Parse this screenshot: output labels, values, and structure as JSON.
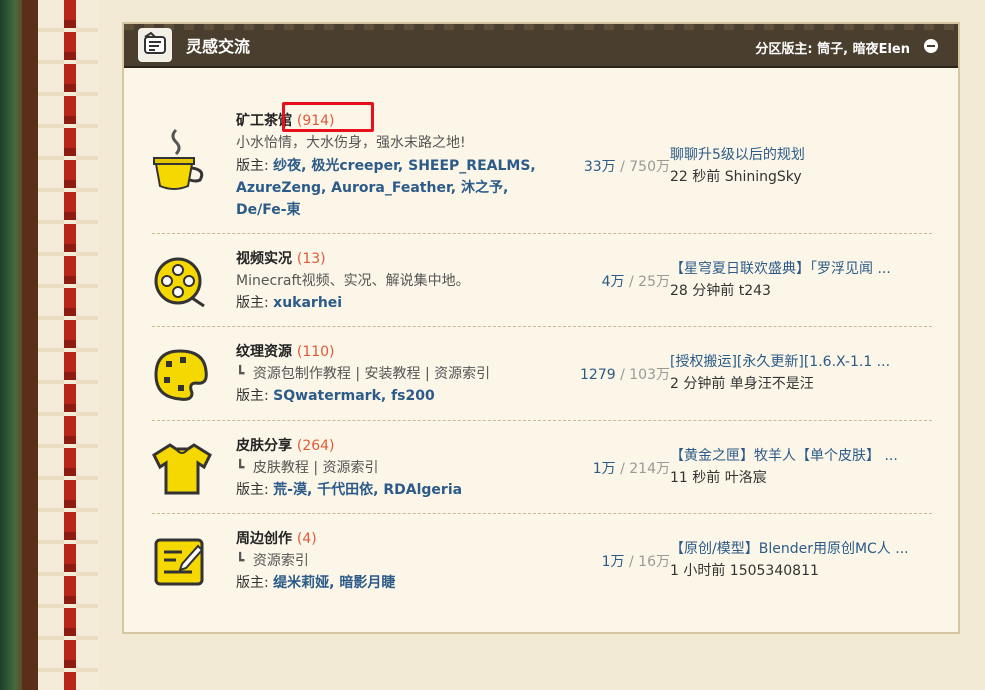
{
  "section": {
    "title": "灵感交流",
    "moderators_label": "分区版主: 筒子, 暗夜Elen"
  },
  "forums": [
    {
      "icon": "teacup-icon",
      "name": "矿工茶馆",
      "count": "(914)",
      "description": "小水怡情，大水伤身，强水末路之地!",
      "mod_label": "版主:",
      "mods_line1": "纱夜, 极光creeper, SHEEP_REALMS,",
      "mods_line2": "AzureZeng, Aurora_Feather, 沐之予,",
      "mods_line3": "De/Fe-東",
      "threads": "33万",
      "posts": "750万",
      "last_title": "聊聊升5级以后的规划",
      "last_meta": "22 秒前 ShiningSky"
    },
    {
      "icon": "film-reel-icon",
      "name": "视频实况",
      "count": "(13)",
      "description": "Minecraft视频、实况、解说集中地。",
      "mod_label": "版主:",
      "mods_line1": "xukarhei",
      "threads": "4万",
      "posts": "25万",
      "last_title": "【星穹夏日联欢盛典】「罗浮见闻 ...",
      "last_meta": "28 分钟前 t243"
    },
    {
      "icon": "palette-icon",
      "name": "纹理资源",
      "count": "(110)",
      "sublinks": "资源包制作教程 | 安装教程 | 资源索引",
      "mod_label": "版主:",
      "mods_line1": "SQwatermark, fs200",
      "threads": "1279",
      "posts": "103万",
      "last_title": "[授权搬运][永久更新][1.6.X-1.1 ...",
      "last_meta": "2 分钟前 单身汪不是汪"
    },
    {
      "icon": "shirt-icon",
      "name": "皮肤分享",
      "count": "(264)",
      "sublinks": "皮肤教程 | 资源索引",
      "mod_label": "版主:",
      "mods_line1": "荒-漠, 千代田依, RDAlgeria",
      "threads": "1万",
      "posts": "214万",
      "last_title": "【黄金之匣】牧羊人【单个皮肤】 ...",
      "last_meta": "11 秒前 叶洛宸"
    },
    {
      "icon": "pencil-note-icon",
      "name": "周边创作",
      "count": "(4)",
      "sublinks": "资源索引",
      "mod_label": "版主:",
      "mods_line1": "缇米莉娅, 暗影月睫",
      "threads": "1万",
      "posts": "16万",
      "last_title": "【原创/模型】Blender用原创MC人 ...",
      "last_meta": "1 小时前 1505340811"
    }
  ],
  "stats_separator": "/",
  "sub_mark": "┗"
}
